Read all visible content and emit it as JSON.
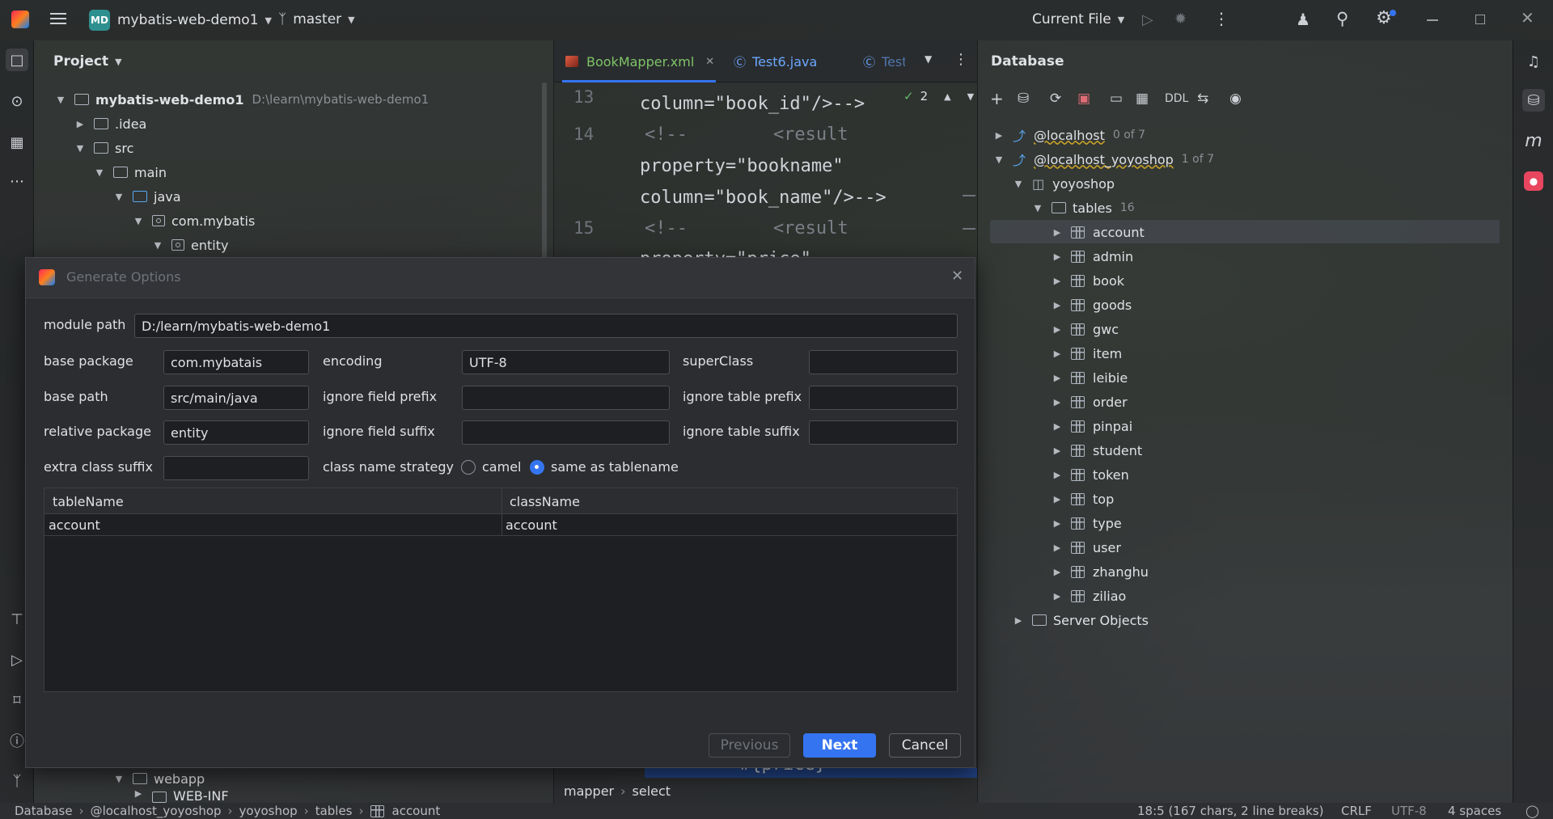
{
  "titlebar": {
    "project_badge": "MD",
    "project_name": "mybatis-web-demo1",
    "branch": "master",
    "run_config": "Current File"
  },
  "project_panel": {
    "title": "Project",
    "tree": [
      {
        "label": "mybatis-web-demo1",
        "path": "D:\\learn\\mybatis-web-demo1"
      },
      {
        "label": ".idea"
      },
      {
        "label": "src"
      },
      {
        "label": "main"
      },
      {
        "label": "java"
      },
      {
        "label": "com.mybatis"
      },
      {
        "label": "entity"
      },
      {
        "label": "webapp"
      },
      {
        "label": "WEB-INF"
      }
    ]
  },
  "editor": {
    "tabs": [
      {
        "label": "BookMapper.xml"
      },
      {
        "label": "Test6.java"
      },
      {
        "label": "Test"
      }
    ],
    "inspection_count": "2",
    "lines": [
      {
        "num": "13",
        "text": "        column=\"book_id\"/>-->"
      },
      {
        "num": "14",
        "text": "<!--        <result"
      },
      {
        "num": "",
        "text": "        property=\"bookname\""
      },
      {
        "num": "",
        "text": "        column=\"book_name\"/>-->"
      },
      {
        "num": "15",
        "text": "<!--        <result"
      },
      {
        "num": "",
        "text": "        property=\"price\""
      }
    ],
    "bottom_code": "#{price}",
    "breadcrumb": [
      "mapper",
      "select"
    ]
  },
  "database_panel": {
    "title": "Database",
    "ddl_label": "DDL",
    "connections": [
      {
        "name": "@localhost",
        "count": "0 of 7"
      },
      {
        "name": "@localhost_yoyoshop",
        "count": "1 of 7"
      }
    ],
    "schema": "yoyoshop",
    "tables_label": "tables",
    "tables_count": "16",
    "tables": [
      "account",
      "admin",
      "book",
      "goods",
      "gwc",
      "item",
      "leibie",
      "order",
      "pinpai",
      "student",
      "token",
      "top",
      "type",
      "user",
      "zhanghu",
      "ziliao"
    ],
    "server_objects": "Server Objects"
  },
  "dialog": {
    "title": "Generate Options",
    "module_path_label": "module path",
    "module_path": "D:/learn/mybatis-web-demo1",
    "base_package_label": "base package",
    "base_package": "com.mybatais",
    "encoding_label": "encoding",
    "encoding": "UTF-8",
    "superclass_label": "superClass",
    "superclass": "",
    "base_path_label": "base path",
    "base_path": "src/main/java",
    "ignore_field_prefix_label": "ignore field prefix",
    "ignore_field_prefix": "",
    "ignore_table_prefix_label": "ignore table prefix",
    "ignore_table_prefix": "",
    "relative_package_label": "relative package",
    "relative_package": "entity",
    "ignore_field_suffix_label": "ignore field suffix",
    "ignore_field_suffix": "",
    "ignore_table_suffix_label": "ignore table suffix",
    "ignore_table_suffix": "",
    "extra_class_suffix_label": "extra class suffix",
    "extra_class_suffix": "",
    "class_name_strategy_label": "class name strategy",
    "strategy_camel": "camel",
    "strategy_same": "same as tablename",
    "grid": {
      "columns": [
        "tableName",
        "className"
      ],
      "rows": [
        [
          "account",
          "account"
        ]
      ]
    },
    "previous_label": "Previous",
    "next_label": "Next",
    "cancel_label": "Cancel"
  },
  "statusbar": {
    "crumbs": [
      "Database",
      "@localhost_yoyoshop",
      "yoyoshop",
      "tables",
      "account"
    ],
    "position": "18:5 (167 chars, 2 line breaks)",
    "line_sep": "CRLF",
    "encoding": "UTF-8",
    "indent": "4 spaces"
  },
  "colors": {
    "accent": "#3574f0",
    "xml_tab": "#7ec468",
    "java_tab": "#6aa7ff"
  }
}
